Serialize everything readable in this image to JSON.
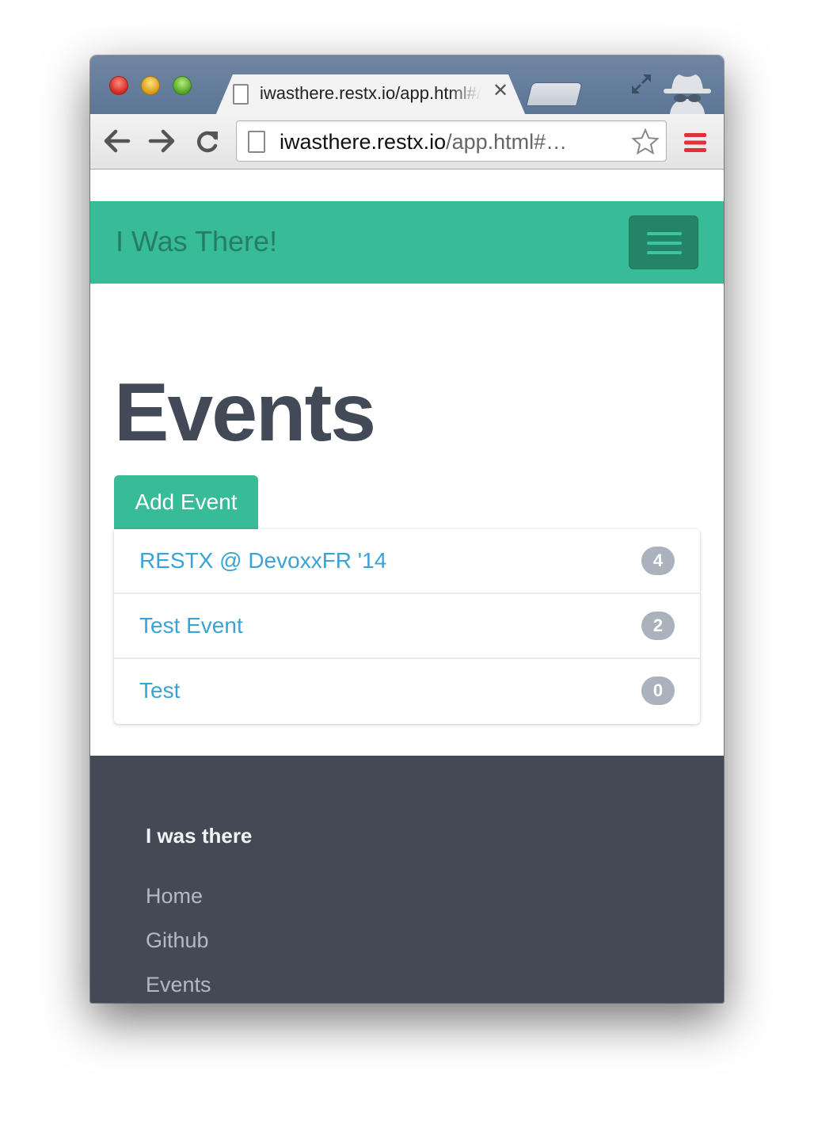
{
  "browser": {
    "tab": {
      "title": "iwasthere.restx.io/app.html#/events",
      "close_glyph": "✕"
    },
    "omnibox": {
      "host": "iwasthere.restx.io",
      "path": "/app.html#…"
    }
  },
  "navbar": {
    "brand": "I Was There!"
  },
  "main": {
    "title": "Events",
    "add_button": "Add Event",
    "events": [
      {
        "name": "RESTX @ DevoxxFR '14",
        "count": "4"
      },
      {
        "name": "Test Event",
        "count": "2"
      },
      {
        "name": "Test",
        "count": "0"
      }
    ]
  },
  "footer": {
    "title": "I was there",
    "links": [
      "Home",
      "Github",
      "Events"
    ]
  },
  "colors": {
    "accent": "#38bc98",
    "footer_bg": "#434a55",
    "link": "#3aa3d6",
    "badge": "#aab2bd",
    "heading": "#414a56"
  },
  "icons": [
    "page-icon",
    "close-icon",
    "fullscreen-icon",
    "incognito-icon",
    "back-arrow-icon",
    "forward-arrow-icon",
    "reload-icon",
    "star-icon",
    "hamburger-menu-icon"
  ]
}
